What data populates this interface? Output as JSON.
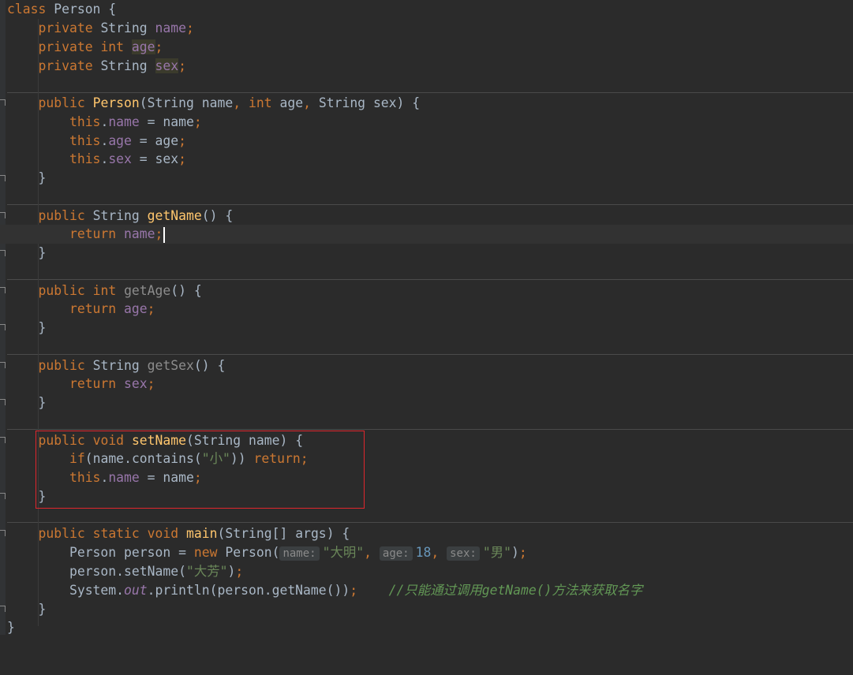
{
  "editor": {
    "class_kw": "class",
    "class_name": "Person",
    "private_kw": "private",
    "public_kw": "public",
    "static_kw": "static",
    "void_kw": "void",
    "int_kw": "int",
    "this_kw": "this",
    "return_kw": "return",
    "if_kw": "if",
    "new_kw": "new",
    "string_type": "String",
    "field_name": "name",
    "field_age": "age",
    "field_sex": "sex",
    "ctor_name": "Person",
    "get_name": "getName",
    "get_age": "getAge",
    "get_sex": "getSex",
    "set_name": "setName",
    "main_name": "main",
    "contains_call": "contains",
    "str_xiao": "\"小\"",
    "main_args": "String[] args",
    "var_person": "person",
    "hint_name": "name:",
    "hint_age": "age:",
    "hint_sex": "sex:",
    "arg_name": "\"大明\"",
    "arg_age": "18",
    "arg_sex": "\"男\"",
    "arg_setname": "\"大芳\"",
    "system": "System",
    "out": "out",
    "println": "println",
    "comment": "//只能通过调用getName()方法来获取名字"
  },
  "colors": {
    "background": "#2b2b2b",
    "keyword": "#cc7832",
    "function": "#ffc66d",
    "field": "#9876aa",
    "string": "#6a8759",
    "number": "#6897bb",
    "comment": "#629755",
    "highlight_box": "#e0262d"
  }
}
